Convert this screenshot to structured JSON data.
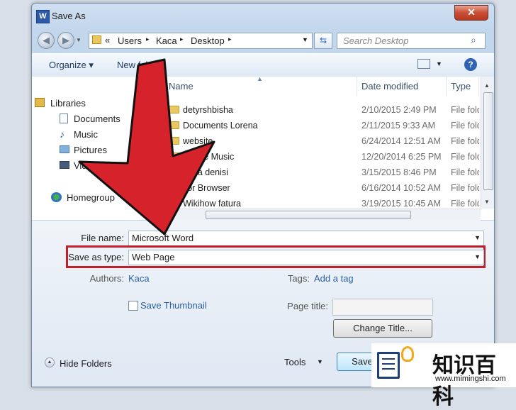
{
  "window": {
    "title": "Save As",
    "app_icon_letter": "W",
    "close_glyph": "✕"
  },
  "address": {
    "segments": [
      "«",
      "Users",
      "Kaca",
      "Desktop"
    ],
    "separator": "▸"
  },
  "search": {
    "placeholder": "Search Desktop"
  },
  "toolbar": {
    "organize": "Organize ▾",
    "new_folder": "New folder",
    "help": "?"
  },
  "sidebar": {
    "items": [
      {
        "label": "Libraries",
        "icon": "libraries-icon"
      },
      {
        "label": "Documents",
        "icon": "documents-icon"
      },
      {
        "label": "Music",
        "icon": "music-icon"
      },
      {
        "label": "Pictures",
        "icon": "pictures-icon"
      },
      {
        "label": "Videos",
        "icon": "videos-icon"
      },
      {
        "label": "Homegroup",
        "icon": "homegroup-icon"
      }
    ]
  },
  "file_list": {
    "columns": {
      "name": "Name",
      "date": "Date modified",
      "type": "Type"
    },
    "rows": [
      {
        "name": "detyrshbisha",
        "date": "2/10/2015 2:49 PM",
        "type": "File folder"
      },
      {
        "name": "Documents Lorena",
        "date": "2/11/2015 9:33 AM",
        "type": "File folder"
      },
      {
        "name": "website",
        "date": "6/24/2014 12:51 AM",
        "type": "File folder"
      },
      {
        "name": "Phone Music",
        "date": "12/20/2014 6:25 PM",
        "type": "File folder"
      },
      {
        "name": "Luna denisi",
        "date": "3/15/2015 8:46 PM",
        "type": "File folder"
      },
      {
        "name": "Tor Browser",
        "date": "6/16/2014 10:52 AM",
        "type": "File folder"
      },
      {
        "name": "Wikihow fatura",
        "date": "3/19/2015 10:45 AM",
        "type": "File folder"
      }
    ]
  },
  "form": {
    "file_name_label": "File name:",
    "file_name_value": "Microsoft Word",
    "save_type_label": "Save as type:",
    "save_type_value": "Web Page",
    "authors_label": "Authors:",
    "authors_value": "Kaca",
    "tags_label": "Tags:",
    "tags_value": "Add a tag",
    "thumbnail_label": "Save Thumbnail",
    "page_title_label": "Page title:",
    "page_title_value": "",
    "change_title_button": "Change Title...",
    "hide_folders": "Hide Folders",
    "tools": "Tools",
    "save_button": "Save"
  },
  "watermark": {
    "text": "知识百科",
    "url": "www.mimingshi.com"
  },
  "colors": {
    "highlight_box": "#c0202c",
    "arrow_fill": "#d6222b",
    "link": "#2a5fa6"
  }
}
